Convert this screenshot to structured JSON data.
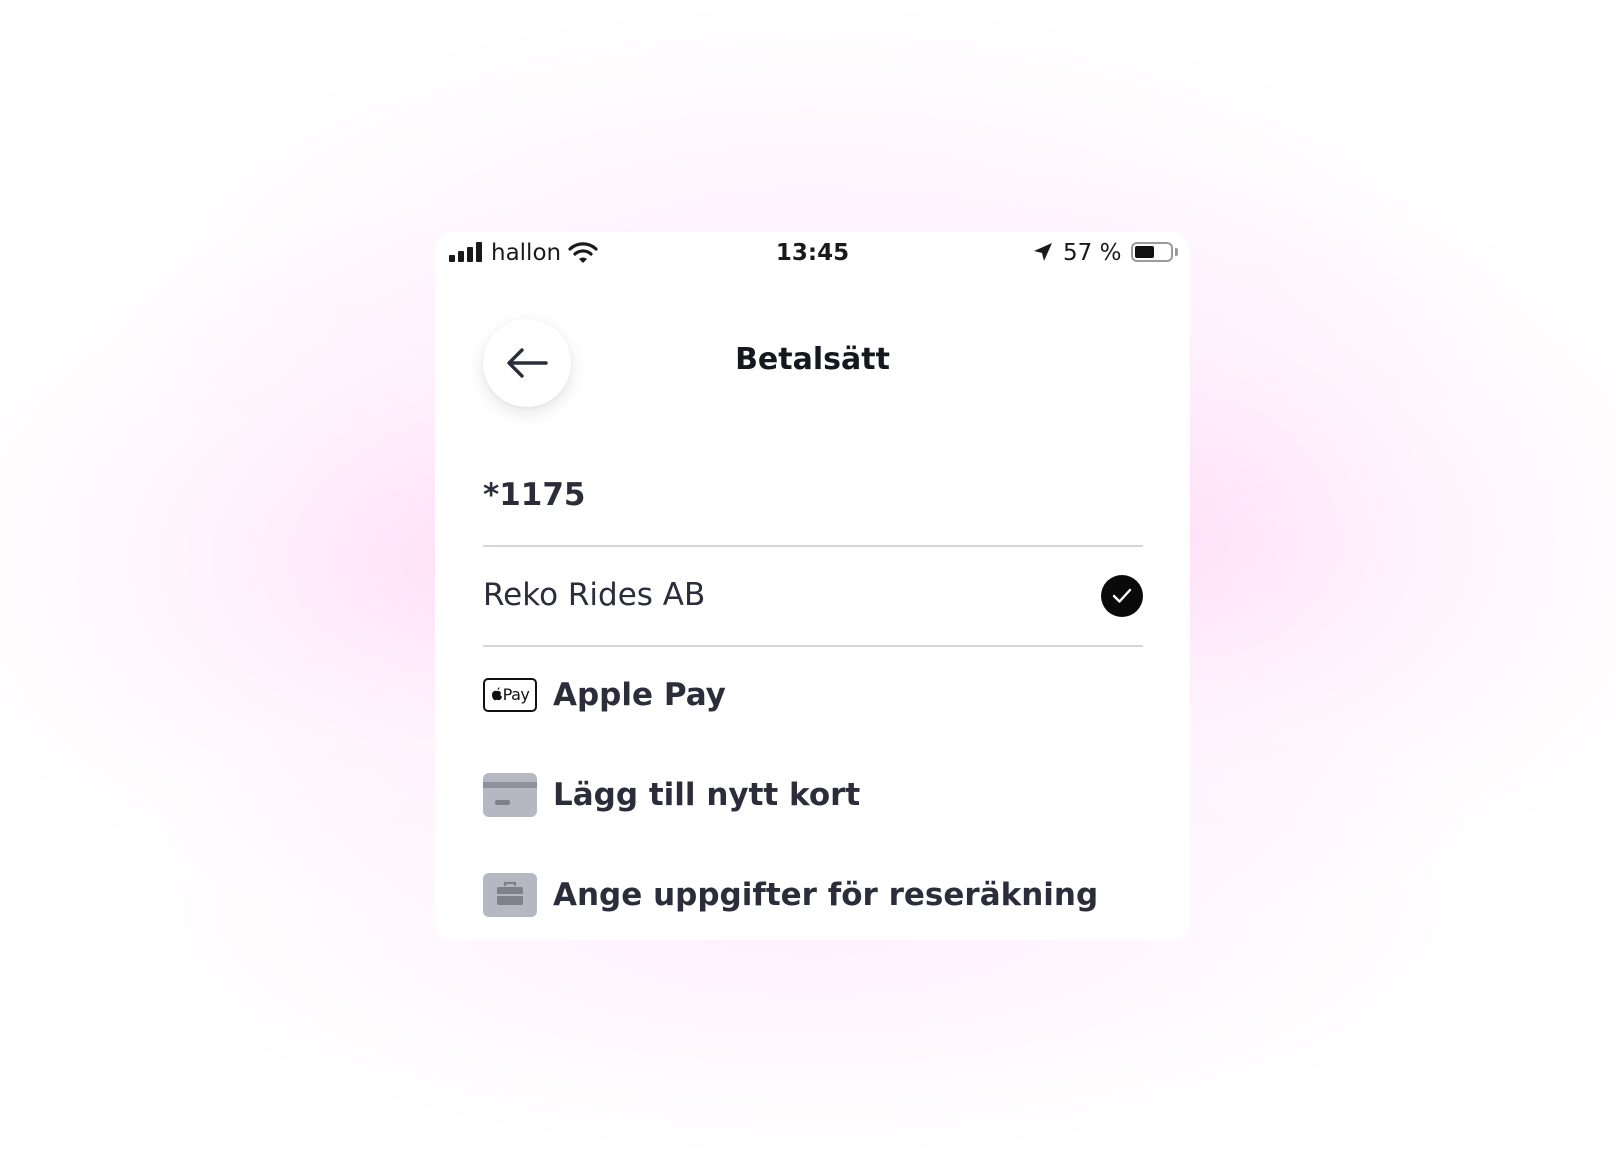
{
  "status_bar": {
    "carrier": "hallon",
    "time": "13:45",
    "battery_percent": "57 %",
    "battery_level": 0.57
  },
  "header": {
    "title": "Betalsätt",
    "back_icon": "arrow-left-icon"
  },
  "payment_methods": [
    {
      "label": "*1175",
      "style": "bold"
    },
    {
      "label": "Reko Rides AB",
      "selected": true,
      "icon": "checkmark-icon"
    },
    {
      "label": "Apple Pay",
      "icon": "apple-pay-icon",
      "icon_text": "Pay"
    },
    {
      "label": "Lägg till nytt kort",
      "icon": "credit-card-icon"
    },
    {
      "label": "Ange uppgifter för reseräkning",
      "icon": "briefcase-icon"
    }
  ],
  "colors": {
    "text": "#2c2d3a",
    "divider": "#d5d6dc",
    "icon_gray": "#b5b8c2",
    "glow": "#ffd6f8"
  }
}
